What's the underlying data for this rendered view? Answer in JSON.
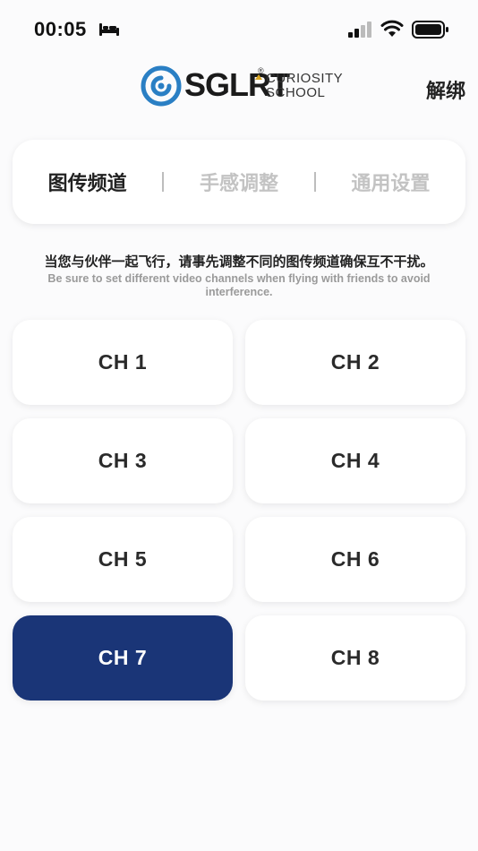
{
  "status_bar": {
    "time": "00:05",
    "icons": [
      "bed-icon",
      "cellular-signal-icon",
      "wifi-icon",
      "battery-icon"
    ]
  },
  "header": {
    "logo": {
      "wordmark": "SGLRT",
      "registered": "®",
      "sub_line1": "CURIOSITY",
      "sub_line2": "SCHOOL",
      "mark_color": "#2a7fc4"
    },
    "unbind_label": "解绑"
  },
  "tabs": [
    {
      "label": "图传频道",
      "active": true
    },
    {
      "label": "手感调整",
      "active": false
    },
    {
      "label": "通用设置",
      "active": false
    }
  ],
  "description": {
    "cn": "当您与伙伴一起飞行，请事先调整不同的图传频道确保互不干扰。",
    "en": "Be sure to set different video channels when flying with friends to avoid interference."
  },
  "channels": [
    {
      "label": "CH 1",
      "selected": false
    },
    {
      "label": "CH 2",
      "selected": false
    },
    {
      "label": "CH 3",
      "selected": false
    },
    {
      "label": "CH 4",
      "selected": false
    },
    {
      "label": "CH 5",
      "selected": false
    },
    {
      "label": "CH 6",
      "selected": false
    },
    {
      "label": "CH 7",
      "selected": true
    },
    {
      "label": "CH 8",
      "selected": false
    }
  ],
  "colors": {
    "selected_channel": "#1a3577",
    "brand_blue": "#2a7fc4",
    "inactive_tab": "#c3c3c3"
  }
}
